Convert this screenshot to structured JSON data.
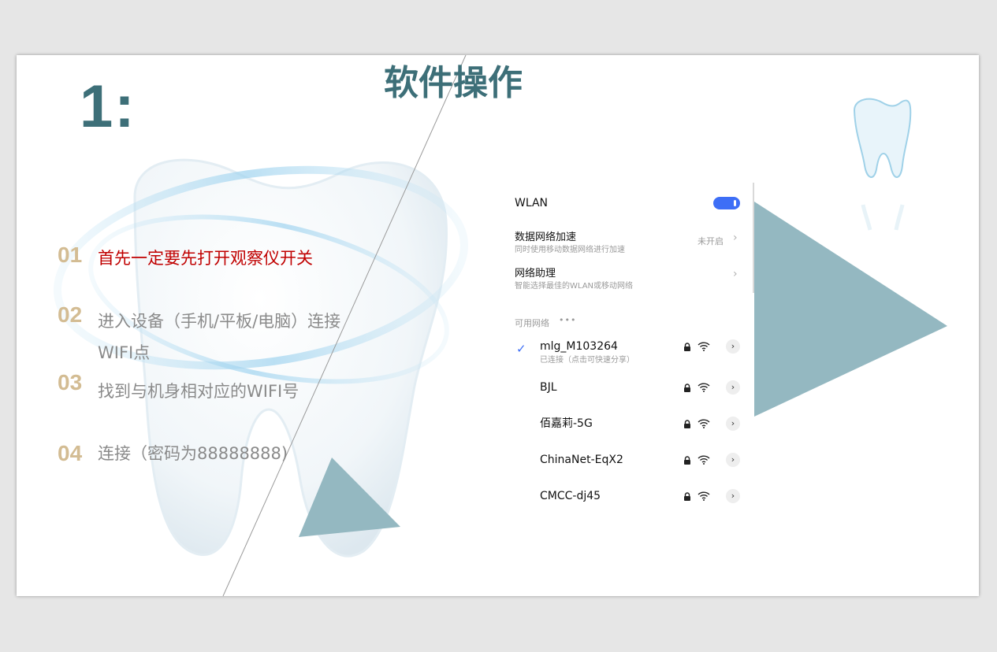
{
  "slide": {
    "number_title": "1:",
    "title": "软件操作"
  },
  "steps": [
    {
      "num": "01",
      "text": "首先一定要先打开观察仪开关"
    },
    {
      "num": "02",
      "text_line1": "进入设备（手机/平板/电脑）连接",
      "text_line2": "WIFI点"
    },
    {
      "num": "03",
      "text": "找到与机身相对应的WIFI号"
    },
    {
      "num": "04",
      "text": "连接（密码为88888888)"
    }
  ],
  "phone": {
    "wlan_label": "WLAN",
    "wlan_on": true,
    "data_accel": {
      "title": "数据网络加速",
      "subtitle": "同时使用移动数据网络进行加速",
      "value": "未开启"
    },
    "assistant": {
      "title": "网络助理",
      "subtitle": "智能选择最佳的WLAN或移动网络"
    },
    "available_label": "可用网络",
    "networks": [
      {
        "name": "mlg_M103264",
        "status": "已连接（点击可快速分享）",
        "connected": true
      },
      {
        "name": "BJL"
      },
      {
        "name": "佰嘉莉-5G"
      },
      {
        "name": "ChinaNet-EqX2"
      },
      {
        "name": "CMCC-dj45"
      }
    ],
    "accent_color": "#3d6ef6"
  },
  "colors": {
    "title": "#3d6f78",
    "step_number": "#d3bc93",
    "step_text": "#8a8a8a",
    "step_highlight": "#c00000",
    "triangle": "#94b8c1"
  },
  "icons": [
    "tooth-icon",
    "lock-icon",
    "wifi-icon",
    "chevron-right-icon",
    "check-icon"
  ]
}
